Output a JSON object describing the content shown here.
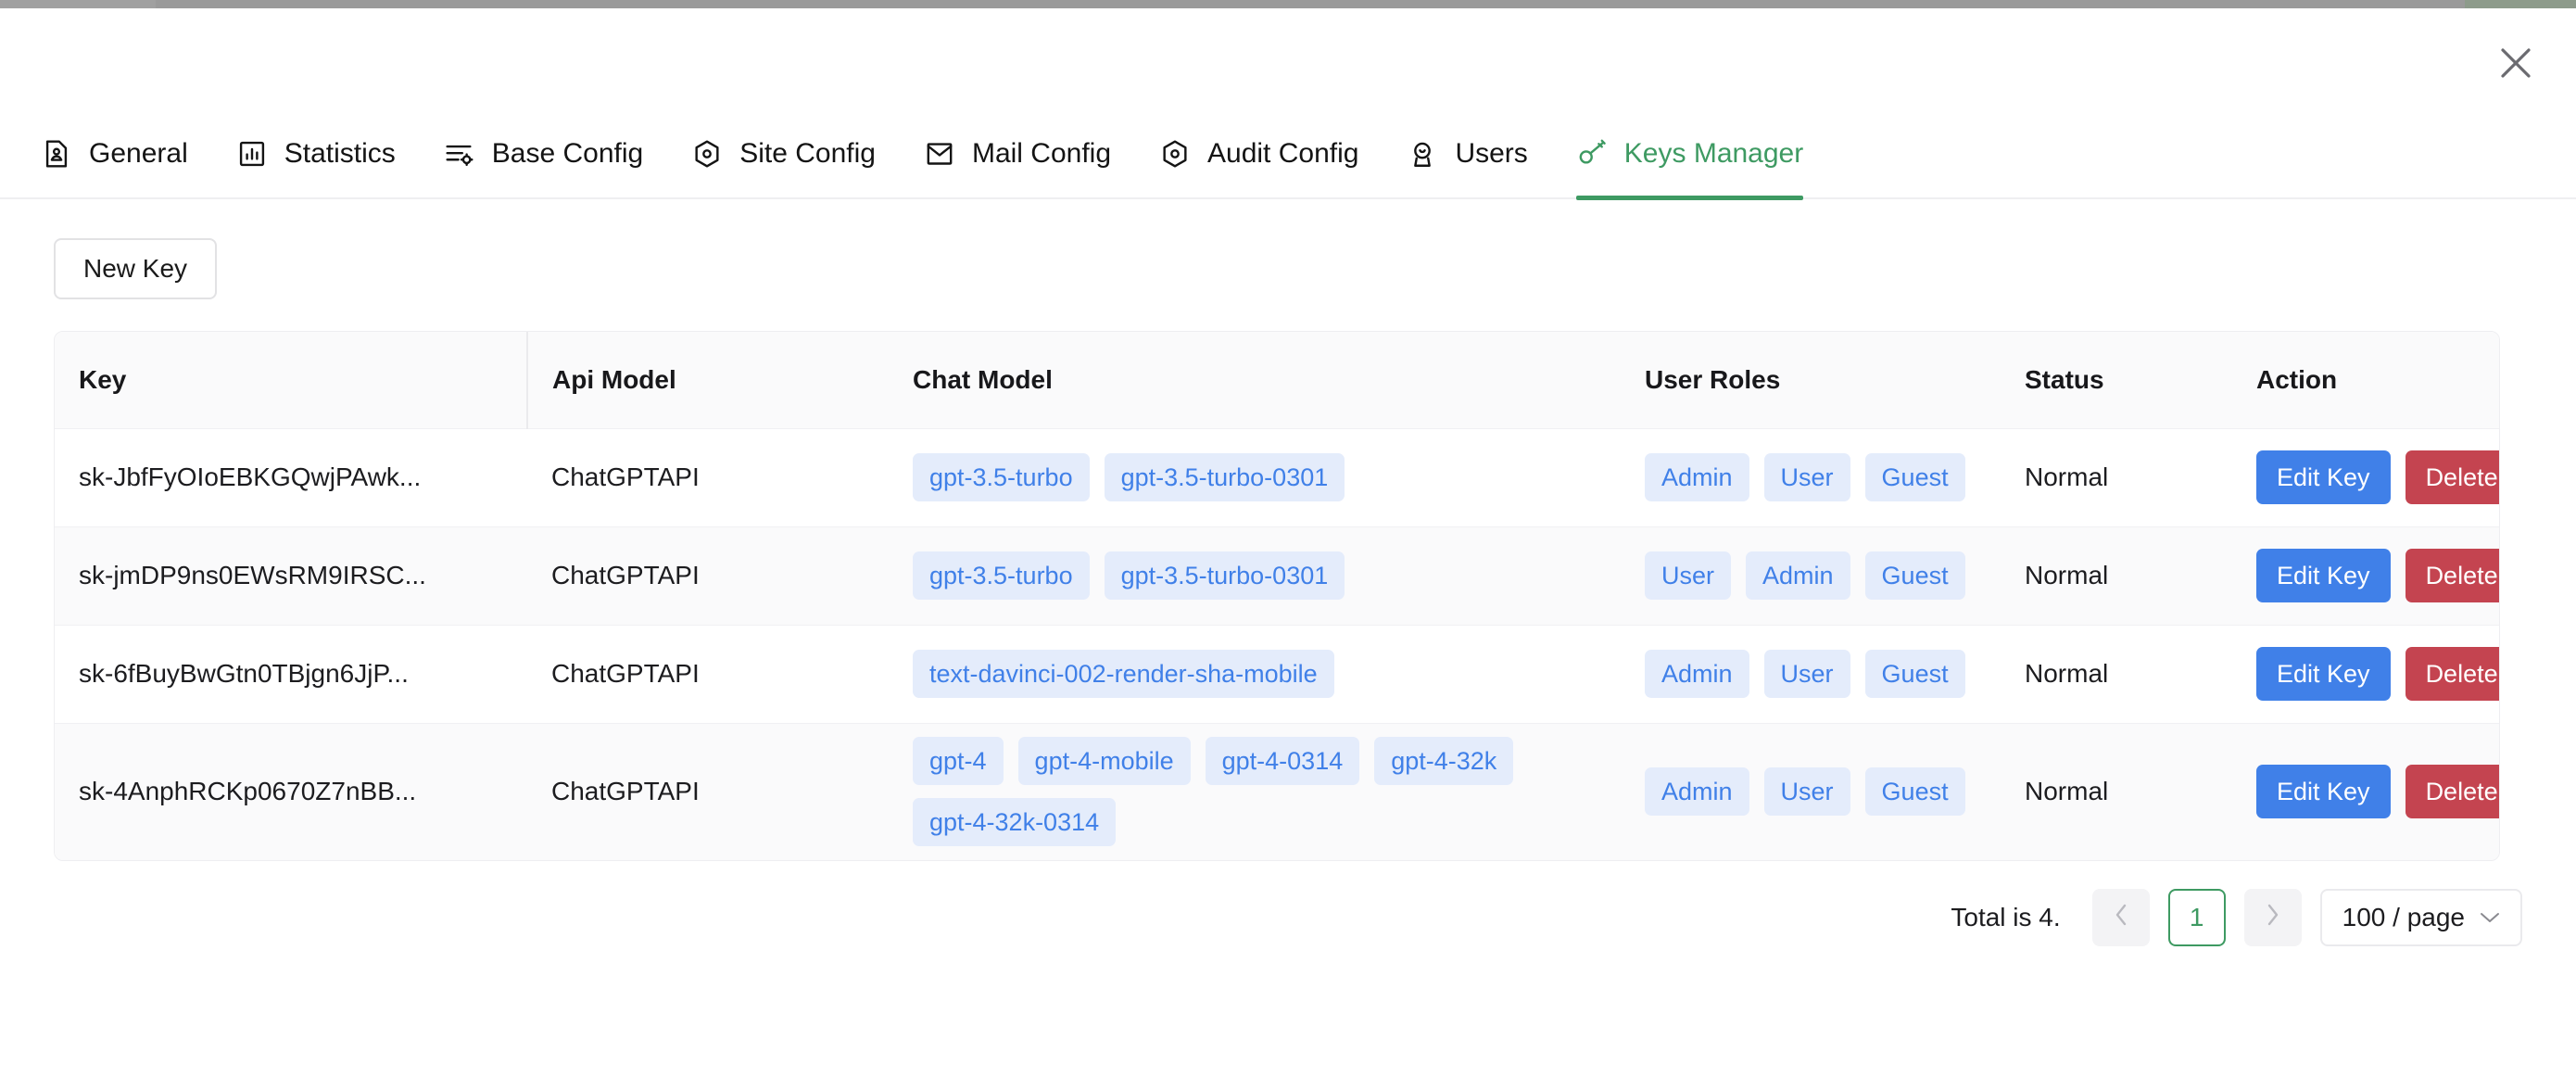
{
  "window": {
    "close_label": "close"
  },
  "tabs": [
    {
      "label": "General",
      "icon": "document-user-icon",
      "active": false
    },
    {
      "label": "Statistics",
      "icon": "bar-chart-icon",
      "active": false
    },
    {
      "label": "Base Config",
      "icon": "sliders-gear-icon",
      "active": false
    },
    {
      "label": "Site Config",
      "icon": "hexagon-dot-icon",
      "active": false
    },
    {
      "label": "Mail Config",
      "icon": "mail-icon",
      "active": false
    },
    {
      "label": "Audit Config",
      "icon": "hexagon-dot-icon",
      "active": false
    },
    {
      "label": "Users",
      "icon": "user-circle-icon",
      "active": false
    },
    {
      "label": "Keys Manager",
      "icon": "key-icon",
      "active": true
    }
  ],
  "toolbar": {
    "new_key_label": "New Key"
  },
  "table": {
    "columns": [
      "Key",
      "Api Model",
      "Chat Model",
      "User Roles",
      "Status",
      "Action"
    ],
    "rows": [
      {
        "key": "sk-JbfFyOIoEBKGQwjPAwk...",
        "api_model": "ChatGPTAPI",
        "chat_models": [
          "gpt-3.5-turbo",
          "gpt-3.5-turbo-0301"
        ],
        "user_roles": [
          "Admin",
          "User",
          "Guest"
        ],
        "status": "Normal",
        "edit_label": "Edit Key",
        "delete_label": "Delete Key"
      },
      {
        "key": "sk-jmDP9ns0EWsRM9IRSC...",
        "api_model": "ChatGPTAPI",
        "chat_models": [
          "gpt-3.5-turbo",
          "gpt-3.5-turbo-0301"
        ],
        "user_roles": [
          "User",
          "Admin",
          "Guest"
        ],
        "status": "Normal",
        "edit_label": "Edit Key",
        "delete_label": "Delete Key"
      },
      {
        "key": "sk-6fBuyBwGtn0TBjgn6JjP...",
        "api_model": "ChatGPTAPI",
        "chat_models": [
          "text-davinci-002-render-sha-mobile"
        ],
        "user_roles": [
          "Admin",
          "User",
          "Guest"
        ],
        "status": "Normal",
        "edit_label": "Edit Key",
        "delete_label": "Delete Key"
      },
      {
        "key": "sk-4AnphRCKp0670Z7nBB...",
        "api_model": "ChatGPTAPI",
        "chat_models": [
          "gpt-4",
          "gpt-4-mobile",
          "gpt-4-0314",
          "gpt-4-32k",
          "gpt-4-32k-0314"
        ],
        "user_roles": [
          "Admin",
          "User",
          "Guest"
        ],
        "status": "Normal",
        "edit_label": "Edit Key",
        "delete_label": "Delete Key"
      }
    ]
  },
  "pagination": {
    "total_text": "Total is 4.",
    "prev_label": "‹",
    "current_page": "1",
    "next_label": "›",
    "page_size": "100 / page"
  },
  "colors": {
    "accent_green": "#3e9a62",
    "tag_bg": "#e4ecfb",
    "tag_text": "#4080e8",
    "edit_blue": "#4080e8",
    "delete_red": "#c44450",
    "header_bg": "#fafafb"
  }
}
